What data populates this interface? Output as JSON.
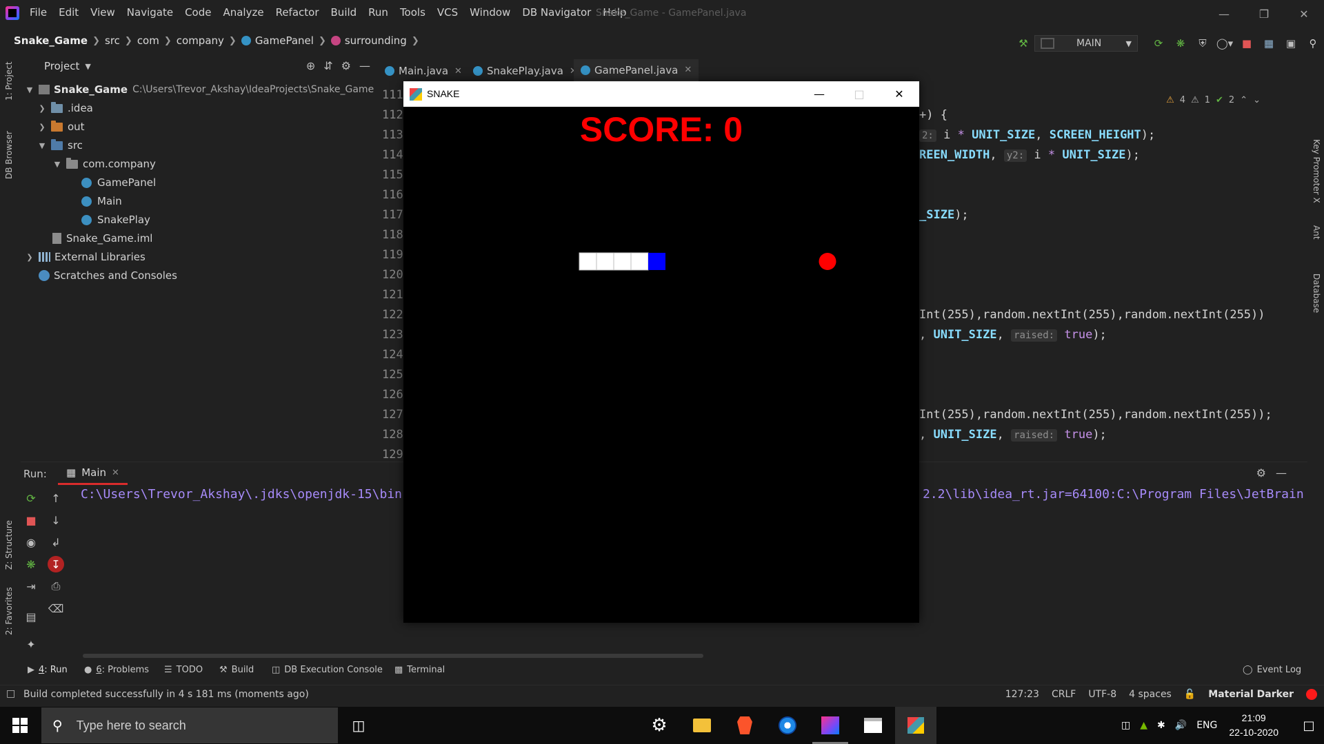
{
  "ide": {
    "menu": [
      "File",
      "Edit",
      "View",
      "Navigate",
      "Code",
      "Analyze",
      "Refactor",
      "Build",
      "Run",
      "Tools",
      "VCS",
      "Window",
      "DB Navigator",
      "Help"
    ],
    "window_title": "Snake_Game - GamePanel.java",
    "breadcrumb": [
      "Snake_Game",
      "src",
      "com",
      "company",
      "GamePanel",
      "surrounding"
    ],
    "run_config": "MAIN",
    "left_stripe": [
      "1: Project",
      "DB Browser",
      "Z: Structure",
      "2: Favorites"
    ],
    "right_stripe": [
      "Key Promoter X",
      "Ant",
      "Database"
    ]
  },
  "project": {
    "title": "Project",
    "tree": [
      {
        "label": "Snake_Game",
        "path": "C:\\Users\\Trevor_Akshay\\IdeaProjects\\Snake_Game",
        "icon": "module-icon",
        "expanded": true
      },
      {
        "label": ".idea",
        "icon": "folder-icon",
        "expanded": false
      },
      {
        "label": "out",
        "icon": "folder-orange-icon",
        "expanded": false
      },
      {
        "label": "src",
        "icon": "source-folder-icon",
        "expanded": true
      },
      {
        "label": "com.company",
        "icon": "package-icon",
        "expanded": true
      },
      {
        "label": "GamePanel",
        "icon": "class-icon"
      },
      {
        "label": "Main",
        "icon": "class-icon"
      },
      {
        "label": "SnakePlay",
        "icon": "class-icon"
      },
      {
        "label": "Snake_Game.iml",
        "icon": "iml-file-icon"
      },
      {
        "label": "External Libraries",
        "icon": "library-icon",
        "expanded": false
      },
      {
        "label": "Scratches and Consoles",
        "icon": "scratches-icon"
      }
    ]
  },
  "editor": {
    "tabs": [
      "Main.java",
      "SnakePlay.java",
      "GamePanel.java"
    ],
    "active_tab": "GamePanel.java",
    "line_numbers": [
      "111",
      "112",
      "113",
      "114",
      "115",
      "116",
      "117",
      "118",
      "119",
      "120",
      "121",
      "122",
      "123",
      "124",
      "125",
      "126",
      "127",
      "128",
      "129"
    ],
    "inspections": {
      "warnings": "4",
      "weak_warnings": "1",
      "ok": "2"
    },
    "code_fragments": {
      "l112": "+) {",
      "l113_hint": "2:",
      "l113_a": "i",
      "l113_b": "UNIT_SIZE",
      "l113_c": "SCREEN_HEIGHT",
      "l114_a": "REEN_WIDTH",
      "l114_hint": "y2:",
      "l114_b": "i",
      "l114_c": "UNIT_SIZE",
      "l117": "_SIZE",
      "l122": "Int(255),random.nextInt(255),random.nextInt(255))",
      "l123_a": "UNIT_SIZE",
      "l123_hint": "raised:",
      "l123_b": "true",
      "l127": "Int(255),random.nextInt(255),random.nextInt(255));",
      "l128_a": "UNIT_SIZE",
      "l128_hint": "raised:",
      "l128_b": "true"
    }
  },
  "run": {
    "label": "Run:",
    "tab": "Main",
    "console_left": "C:\\Users\\Trevor_Akshay\\.jdks\\openjdk-15\\bin",
    "console_right": "2.2\\lib\\idea_rt.jar=64100:C:\\Program Files\\JetBrain"
  },
  "tool_windows": [
    {
      "key": "4",
      "label": ": Run"
    },
    {
      "key": "6",
      "label": ": Problems"
    },
    {
      "key": "",
      "label": "TODO"
    },
    {
      "key": "",
      "label": "Build"
    },
    {
      "key": "",
      "label": "DB Execution Console"
    },
    {
      "key": "",
      "label": "Terminal"
    }
  ],
  "event_log": "Event Log",
  "status": {
    "message": "Build completed successfully in 4 s 181 ms (moments ago)",
    "position": "127:23",
    "line_sep": "CRLF",
    "encoding": "UTF-8",
    "indent": "4 spaces",
    "theme": "Material Darker"
  },
  "game": {
    "title": "SNAKE",
    "score_label": "SCORE: 0",
    "grid_unit": 25,
    "snake_body_cells": [
      [
        10,
        8
      ],
      [
        11,
        8
      ],
      [
        12,
        8
      ],
      [
        13,
        8
      ]
    ],
    "snake_head_cell": [
      14,
      8
    ],
    "apple_cell": [
      22,
      8
    ],
    "colors": {
      "body": "#ffffff",
      "head": "#0000ff",
      "apple": "#ff0000",
      "score": "#ff0000",
      "background": "#000000"
    }
  },
  "taskbar": {
    "search_placeholder": "Type here to search",
    "language": "ENG",
    "time": "21:09",
    "date": "22-10-2020"
  }
}
